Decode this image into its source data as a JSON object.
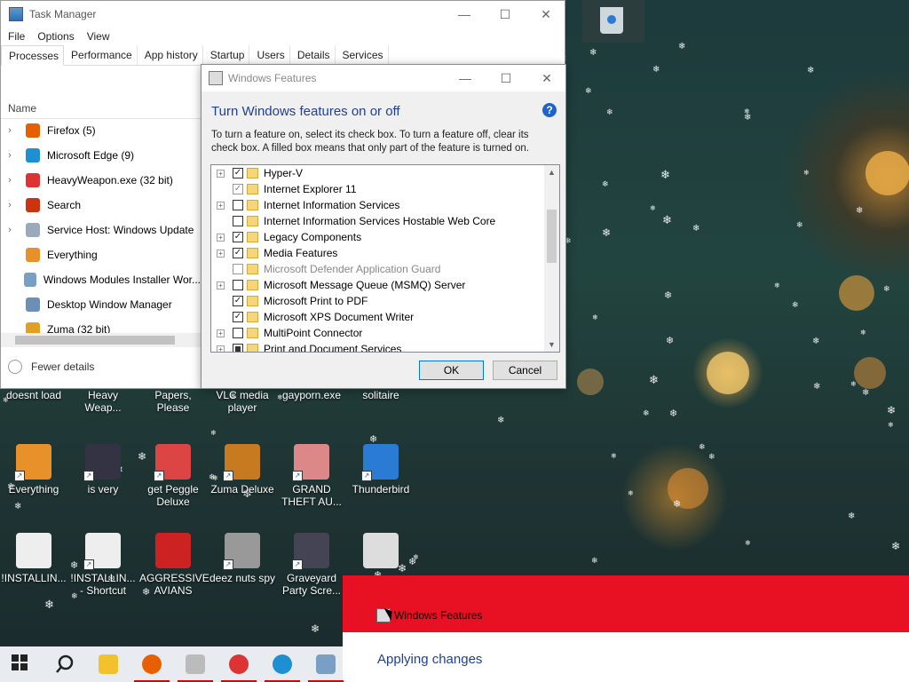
{
  "task_manager": {
    "title": "Task Manager",
    "menu": [
      "File",
      "Options",
      "View"
    ],
    "tabs": [
      "Processes",
      "Performance",
      "App history",
      "Startup",
      "Users",
      "Details",
      "Services"
    ],
    "column_name": "Name",
    "processes": [
      {
        "name": "Firefox (5)",
        "color": "#e66000",
        "expandable": true
      },
      {
        "name": "Microsoft Edge (9)",
        "color": "#1f8fd4",
        "expandable": true
      },
      {
        "name": "HeavyWeapon.exe (32 bit)",
        "color": "#d33",
        "expandable": true
      },
      {
        "name": "Search",
        "color": "#c31",
        "expandable": true
      },
      {
        "name": "Service Host: Windows Update",
        "color": "#9ab",
        "expandable": true
      },
      {
        "name": "Everything",
        "color": "#e8912a",
        "expandable": false
      },
      {
        "name": "Windows Modules Installer Wor...",
        "color": "#7a9fc4",
        "expandable": false
      },
      {
        "name": "Desktop Window Manager",
        "color": "#6b8fb5",
        "expandable": false
      },
      {
        "name": "Zuma (32 bit)",
        "color": "#e2a020",
        "expandable": false
      }
    ],
    "fewer_details": "Fewer details"
  },
  "windows_features": {
    "title": "Windows Features",
    "heading": "Turn Windows features on or off",
    "help": "?",
    "description": "To turn a feature on, select its check box. To turn a feature off, clear its check box. A filled box means that only part of the feature is turned on.",
    "features": [
      {
        "label": "Hyper-V",
        "state": "checked",
        "expandable": true
      },
      {
        "label": "Internet Explorer 11",
        "state": "checked-disabled",
        "expandable": false
      },
      {
        "label": "Internet Information Services",
        "state": "unchecked",
        "expandable": true
      },
      {
        "label": "Internet Information Services Hostable Web Core",
        "state": "unchecked",
        "expandable": false
      },
      {
        "label": "Legacy Components",
        "state": "checked",
        "expandable": true
      },
      {
        "label": "Media Features",
        "state": "checked",
        "expandable": true
      },
      {
        "label": "Microsoft Defender Application Guard",
        "state": "disabled",
        "expandable": false
      },
      {
        "label": "Microsoft Message Queue (MSMQ) Server",
        "state": "unchecked",
        "expandable": true
      },
      {
        "label": "Microsoft Print to PDF",
        "state": "checked",
        "expandable": false
      },
      {
        "label": "Microsoft XPS Document Writer",
        "state": "checked",
        "expandable": false
      },
      {
        "label": "MultiPoint Connector",
        "state": "unchecked",
        "expandable": true
      },
      {
        "label": "Print and Document Services",
        "state": "partial",
        "expandable": true
      }
    ],
    "ok": "OK",
    "cancel": "Cancel"
  },
  "desktop_icons": [
    {
      "label": "doesnt load",
      "color": "#7a8a99",
      "shortcut": false
    },
    {
      "label": "Heavy Weap...",
      "color": "#a33",
      "shortcut": false
    },
    {
      "label": "Papers, Please",
      "color": "#666",
      "shortcut": false
    },
    {
      "label": "VLC media player",
      "color": "#f08a00",
      "shortcut": false
    },
    {
      "label": "gayporn.exe",
      "color": "#777",
      "shortcut": false
    },
    {
      "label": "solitaire",
      "color": "#2a6",
      "shortcut": false
    },
    {
      "label": "Everything",
      "color": "#e8912a",
      "shortcut": true
    },
    {
      "label": "is very",
      "color": "#334",
      "shortcut": true
    },
    {
      "label": "get Peggle Deluxe",
      "color": "#d44",
      "shortcut": true
    },
    {
      "label": "Zuma Deluxe",
      "color": "#c77a20",
      "shortcut": true
    },
    {
      "label": "GRAND THEFT AU...",
      "color": "#d88",
      "shortcut": true
    },
    {
      "label": "Thunderbird",
      "color": "#2a7bd4",
      "shortcut": true
    },
    {
      "label": "!INSTALLIN...",
      "color": "#eee",
      "shortcut": false
    },
    {
      "label": "!INSTALLIN... - Shortcut",
      "color": "#eee",
      "shortcut": true
    },
    {
      "label": "AGGRESSIVE AVIANS",
      "color": "#c22",
      "shortcut": false
    },
    {
      "label": "deez nuts spy",
      "color": "#999",
      "shortcut": true
    },
    {
      "label": "Graveyard Party Scre...",
      "color": "#445",
      "shortcut": true
    },
    {
      "label": "",
      "color": "#ddd",
      "shortcut": false
    }
  ],
  "notification": {
    "app": "Windows Features",
    "message": "Applying changes"
  },
  "taskbar": [
    {
      "name": "start",
      "color": "#222",
      "open": false
    },
    {
      "name": "search",
      "color": "#222",
      "open": false
    },
    {
      "name": "file-explorer",
      "color": "#f2c12e",
      "open": false
    },
    {
      "name": "firefox",
      "color": "#e66000",
      "open": true
    },
    {
      "name": "windows-features",
      "color": "#bbb",
      "open": true
    },
    {
      "name": "heavyweapon",
      "color": "#d33",
      "open": true
    },
    {
      "name": "edge",
      "color": "#1f8fd4",
      "open": true
    },
    {
      "name": "task-manager",
      "color": "#7a9fc4",
      "open": true
    }
  ]
}
